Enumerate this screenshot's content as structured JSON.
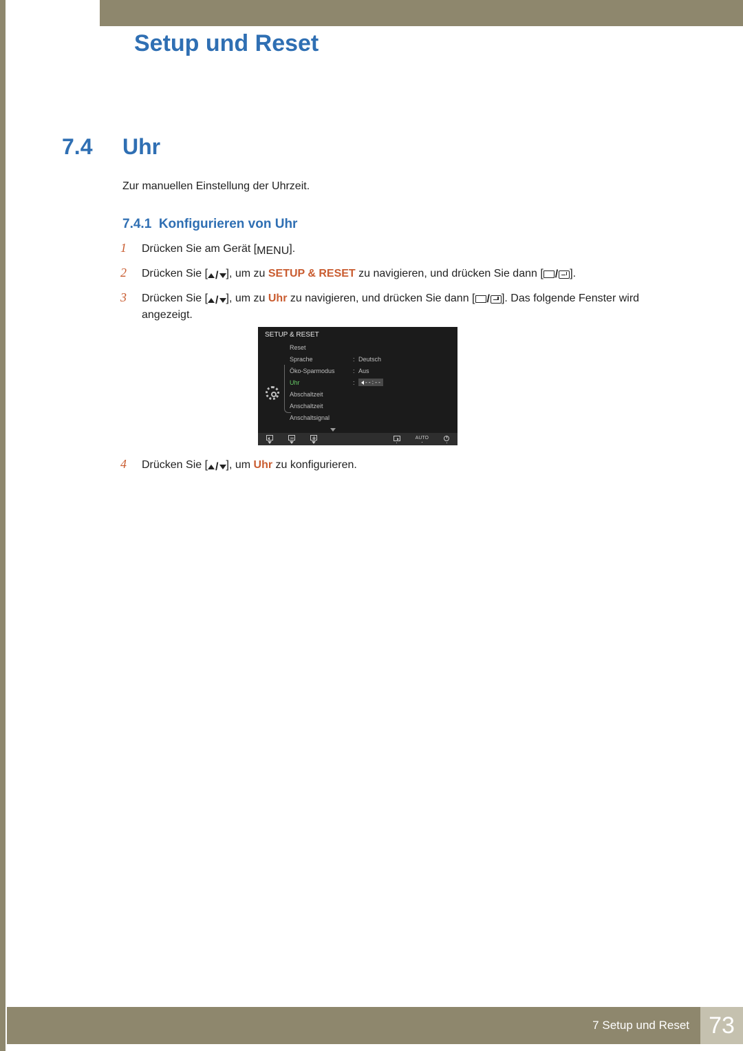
{
  "header": {
    "title": "Setup und Reset"
  },
  "section": {
    "number": "7.4",
    "title": "Uhr",
    "description": "Zur manuellen Einstellung der Uhrzeit."
  },
  "subsection": {
    "number": "7.4.1",
    "title": "Konfigurieren von Uhr"
  },
  "steps": {
    "s1_a": "Drücken Sie am Gerät [",
    "s1_menu": "MENU",
    "s1_b": "].",
    "s2_a": "Drücken Sie [",
    "s2_b": "], um zu ",
    "s2_target": "SETUP & RESET",
    "s2_c": " zu navigieren, und drücken Sie dann [",
    "s2_d": "].",
    "s3_a": "Drücken Sie [",
    "s3_b": "], um zu ",
    "s3_target": "Uhr",
    "s3_c": " zu navigieren, und drücken Sie dann [",
    "s3_d": "]. Das folgende Fenster wird angezeigt.",
    "s4_a": "Drücken Sie [",
    "s4_b": "], um ",
    "s4_target": "Uhr",
    "s4_c": " zu konfigurieren."
  },
  "osd": {
    "title": "SETUP & RESET",
    "rows": [
      {
        "label": "Reset",
        "value": ""
      },
      {
        "label": "Sprache",
        "value": "Deutsch"
      },
      {
        "label": "Öko-Sparmodus",
        "value": "Aus"
      },
      {
        "label": "Uhr",
        "value": "- - :  - -",
        "selected": true
      },
      {
        "label": "Abschaltzeit",
        "value": ""
      },
      {
        "label": "Anschaltzeit",
        "value": ""
      },
      {
        "label": "Anschaltsignal",
        "value": ""
      }
    ],
    "auto": "AUTO"
  },
  "footer": {
    "chapter": "7 Setup und Reset",
    "page": "73"
  },
  "nums": {
    "n1": "1",
    "n2": "2",
    "n3": "3",
    "n4": "4"
  }
}
